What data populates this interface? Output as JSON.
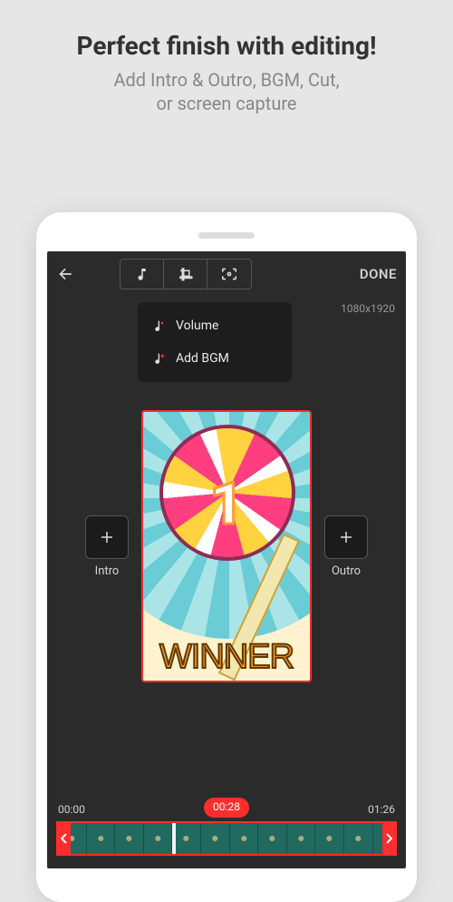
{
  "promo": {
    "title": "Perfect finish with editing!",
    "subtitle": "Add Intro & Outro, BGM, Cut,\nor screen capture"
  },
  "topbar": {
    "done": "DONE",
    "resolution": "1080x1920"
  },
  "dropdown": {
    "volume": "Volume",
    "add_bgm": "Add BGM"
  },
  "sidebuttons": {
    "intro": "Intro",
    "outro": "Outro"
  },
  "preview": {
    "rank": "1",
    "banner": "WINNER"
  },
  "timeline": {
    "start": "00:00",
    "current": "00:28",
    "end": "01:26"
  }
}
